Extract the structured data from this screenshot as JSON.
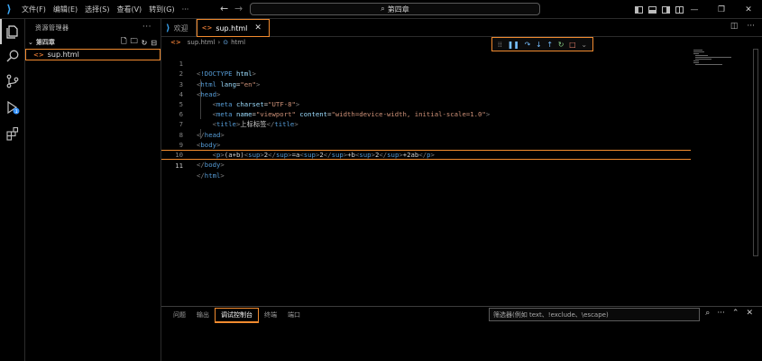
{
  "titlebar": {
    "menu": [
      "文件(F)",
      "编辑(E)",
      "选择(S)",
      "查看(V)",
      "转到(G)",
      "···"
    ],
    "search_text": "第四章",
    "win_minimize": "—",
    "win_restore": "❐",
    "win_close": "✕"
  },
  "sidebar": {
    "title": "资源管理器",
    "more": "···",
    "folder_name": "第四章",
    "file_name": "sup.html"
  },
  "tabs": [
    {
      "label": "欢迎",
      "icon": "vscode-logo-icon"
    },
    {
      "label": "sup.html",
      "icon": "html-file-icon",
      "close": "✕"
    }
  ],
  "breadcrumb": {
    "file": "sup.html",
    "sep": "›",
    "element": "html"
  },
  "code": {
    "line_numbers": [
      "1",
      "2",
      "3",
      "4",
      "5",
      "6",
      "7",
      "8",
      "9",
      "10",
      "11"
    ],
    "l1_doctype": "!DOCTYPE",
    "l1_html": "html",
    "l2_tag": "html",
    "l2_attr": "lang",
    "l2_val": "\"en\"",
    "l3_tag": "head",
    "l4_tag": "meta",
    "l4_attr": "charset",
    "l4_val": "\"UTF-8\"",
    "l5_tag": "meta",
    "l5_attr1": "name",
    "l5_val1": "\"viewport\"",
    "l5_attr2": "content",
    "l5_val2": "\"width=device-width, initial-scale=1.0\"",
    "l6_tag": "title",
    "l6_text": "上标标签",
    "l7_tag": "head",
    "l8_tag": "body",
    "l9_p": "p",
    "l9_t1": "(a+b)",
    "l9_sup": "sup",
    "l9_n2": "2",
    "l9_t2": "=a",
    "l9_t3": "+b",
    "l9_t4": "+2ab",
    "l10_tag": "body",
    "l11_tag": "html"
  },
  "panel": {
    "tabs": [
      "问题",
      "输出",
      "调试控制台",
      "终端",
      "端口"
    ],
    "active_tab": "调试控制台",
    "filter_placeholder": "筛选器(例如 text、!exclude、\\escape)"
  },
  "colors": {
    "accent_border": "#f28b2f",
    "tag": "#569cd6",
    "attr": "#9cdcfe",
    "string": "#ce9178"
  }
}
